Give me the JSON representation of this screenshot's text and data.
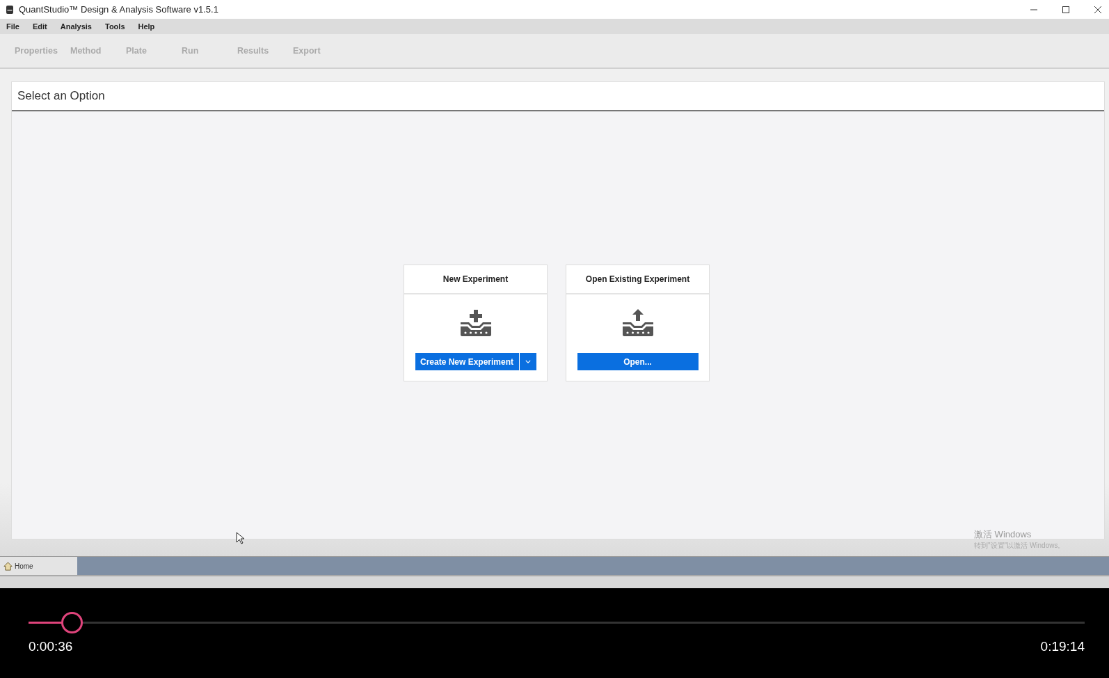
{
  "window": {
    "title": "QuantStudio™ Design & Analysis Software v1.5.1"
  },
  "menu": [
    "File",
    "Edit",
    "Analysis",
    "Tools",
    "Help"
  ],
  "steps": [
    {
      "label": "Properties",
      "disabled": true
    },
    {
      "label": "Method",
      "disabled": true
    },
    {
      "label": "Plate",
      "disabled": true
    },
    {
      "label": "Run",
      "disabled": true
    },
    {
      "label": "Results",
      "disabled": true
    },
    {
      "label": "Export",
      "disabled": true
    }
  ],
  "panel": {
    "title": "Select an Option"
  },
  "cards": [
    {
      "kind": "new",
      "title": "New Experiment",
      "button": "Create New Experiment",
      "has_dropdown": true
    },
    {
      "kind": "open",
      "title": "Open Existing Experiment",
      "button": "Open...",
      "has_dropdown": false
    }
  ],
  "activation_notice": {
    "title": "激活 Windows",
    "text": "转到\"设置\"以激活 Windows。"
  },
  "home_tab": {
    "label": "Home",
    "selected": true
  },
  "player": {
    "level": 0.041,
    "elapsed": "0:00:36",
    "duration": "0:19:14"
  }
}
